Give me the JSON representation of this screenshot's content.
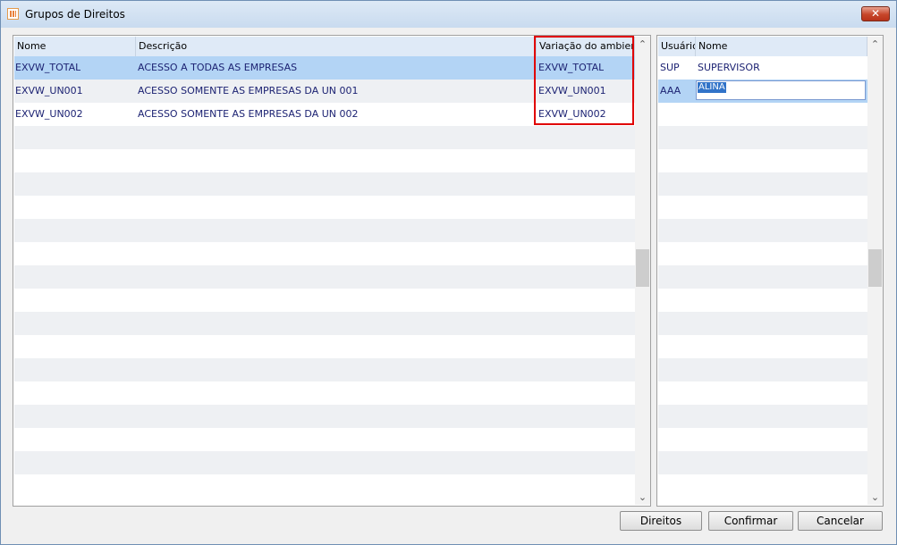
{
  "window": {
    "title": "Grupos de Direitos",
    "close_glyph": "✕"
  },
  "groups_table": {
    "columns": [
      "Nome",
      "Descrição",
      "Variação do ambiente"
    ],
    "rows": [
      {
        "nome": "EXVW_TOTAL",
        "descricao": "ACESSO A TODAS AS EMPRESAS",
        "variacao": "EXVW_TOTAL"
      },
      {
        "nome": "EXVW_UN001",
        "descricao": "ACESSO SOMENTE AS EMPRESAS DA UN 001",
        "variacao": "EXVW_UN001"
      },
      {
        "nome": "EXVW_UN002",
        "descricao": "ACESSO SOMENTE AS EMPRESAS DA UN 002",
        "variacao": "EXVW_UN002"
      }
    ]
  },
  "users_table": {
    "columns": [
      "Usuário",
      "Nome"
    ],
    "rows": [
      {
        "usuario": "SUP",
        "nome": "SUPERVISOR"
      },
      {
        "usuario": "AAA",
        "nome": "ALINA"
      }
    ]
  },
  "scroll": {
    "up": "⌃",
    "down": "⌄"
  },
  "buttons": {
    "direitos": "Direitos",
    "confirmar": "Confirmar",
    "cancelar": "Cancelar"
  },
  "colors": {
    "selected_row": "#b3d4f5",
    "highlight": "#e00000",
    "text": "#1d2373"
  }
}
